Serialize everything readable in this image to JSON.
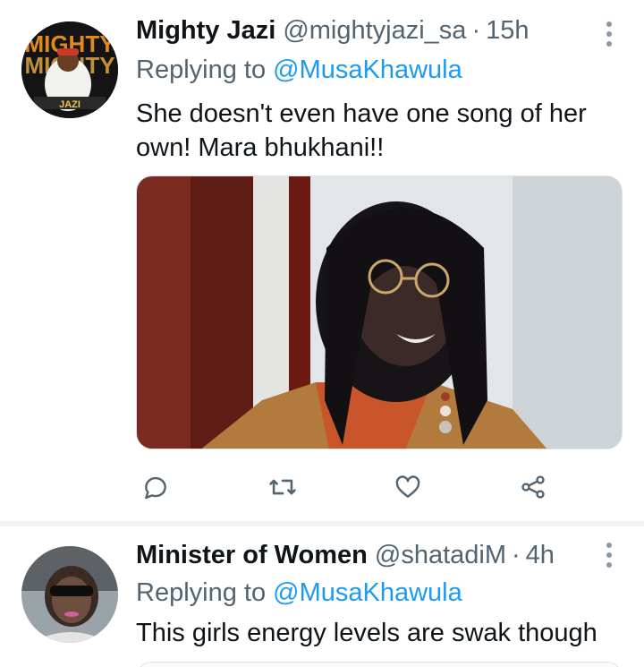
{
  "tweets": [
    {
      "display_name": "Mighty Jazi",
      "handle": "@mightyjazi_sa",
      "separator": "·",
      "time": "15h",
      "replying_prefix": "Replying to",
      "replying_to": "@MusaKhawula",
      "text": "She doesn't even have one song of her own! Mara bhukhani!!",
      "avatar_overlay_text": "MIGHTY",
      "avatar_caption": "JAZI",
      "has_media": true,
      "actions": [
        "reply-icon",
        "retweet-icon",
        "like-icon",
        "share-icon"
      ]
    },
    {
      "display_name": "Minister of Women",
      "handle": "@shatadiM",
      "separator": "·",
      "time": "4h",
      "replying_prefix": "Replying to",
      "replying_to": "@MusaKhawula",
      "text": "This girls energy levels are swak though"
    }
  ],
  "colors": {
    "text_primary": "#0f1419",
    "text_secondary": "#536471",
    "link": "#1d9bf0",
    "divider": "#eff3f4"
  }
}
